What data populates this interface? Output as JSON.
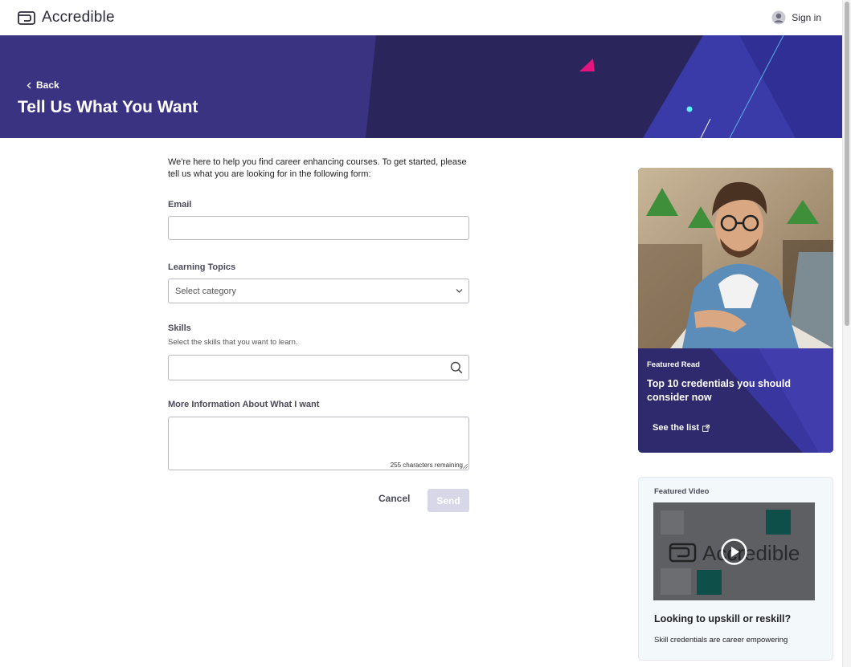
{
  "nav": {
    "brand": "Accredible",
    "signin": "Sign in"
  },
  "hero": {
    "back": "Back",
    "title": "Tell Us What You Want"
  },
  "form": {
    "intro": "We're here to help you find career enhancing courses. To get started, please tell us what you are looking for in the following form:",
    "email_label": "Email",
    "email_value": "",
    "topics_label": "Learning Topics",
    "topics_selected": "Select category",
    "skills_label": "Skills",
    "skills_hint": "Select the skills that you want to learn.",
    "skills_value": "",
    "more_label": "More Information About What I want",
    "more_value": "",
    "counter": "255 characters remaining",
    "cancel": "Cancel",
    "send": "Send"
  },
  "featured_read": {
    "kicker": "Featured Read",
    "title": "Top 10 credentials you should consider now",
    "link": "See the list"
  },
  "featured_video": {
    "kicker": "Featured Video",
    "thumb_text": "Accredible",
    "title": "Looking to upskill or reskill?",
    "desc": "Skill credentials are career empowering"
  },
  "colors": {
    "hero": "#3a3381",
    "accent_pink": "#e5147f",
    "accent_cyan": "#5ef0f4",
    "send_disabled": "#d8d7e8"
  }
}
